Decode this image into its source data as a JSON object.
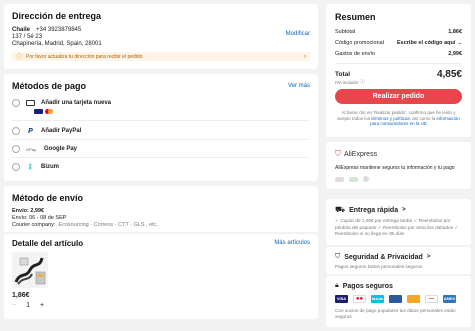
{
  "shipping_address": {
    "title": "Dirección de entrega",
    "name": "Chaile",
    "phone": "+34 3923879845",
    "street": "137 / 5é 23",
    "city": "Chapinería, Madrid, Spain, 28001",
    "edit_label": "Modificar",
    "notice": "Por favor actualiza tu dirección para recibir el pedido"
  },
  "payment": {
    "title": "Métodos de pago",
    "more_label": "Ver más",
    "methods": [
      {
        "label": "Añadir una tarjeta nueva"
      },
      {
        "label": "Añadir PayPal"
      },
      {
        "label": "Google Pay",
        "badge": "GPay"
      },
      {
        "label": "Bizum"
      }
    ]
  },
  "shipping_method": {
    "title": "Método de envío",
    "cost": "Envío: 2,99€",
    "eta": "Envío: 06 - 08 de SEP",
    "couriers_label": "Courier company:",
    "couriers": "Ecosourcing · Correos · CTT · GLS , etc."
  },
  "item_detail": {
    "title": "Detalle del artículo",
    "more_label": "Más artículos",
    "price": "1,86€",
    "quantity": "1",
    "minus": "−",
    "plus": "+"
  },
  "summary": {
    "title": "Resumen",
    "subtotal_label": "Subtotal",
    "subtotal_value": "1,86€",
    "promo_label": "Código promocional",
    "promo_value": "Escribe el código aquí",
    "shipping_label": "Gastos de envío",
    "shipping_value": "2,99€",
    "total_label": "Total",
    "total_value": "4,85€",
    "tax_note": "IVA incluido",
    "order_button": "Realizar pedido",
    "legal_prefix": "Al hacer clic en 'Realizar pedido', confirmo que he leído y acepto todos los",
    "legal_terms": "términos y políticas",
    "legal_mid": ", así como la",
    "legal_info": "información para consumidores en la UE"
  },
  "aliexpress": {
    "brand": "AliExpress",
    "text": "AliExpress mantiene seguros tu información y tu pago"
  },
  "delivery": {
    "title": "Entrega rápida",
    "chevron": ">",
    "text": "✓ Cupón de 1,00€ por entrega tardía  ✓ Reembolso por pérdida del paquete  ✓ Reembolso por artículos dañados  ✓ Reembolso si no llega en 35 días"
  },
  "security": {
    "title": "Seguridad & Privacidad",
    "chevron": ">",
    "text": "Pagos seguros   Datos personales seguros"
  },
  "secure_payments": {
    "title": "Pagos seguros",
    "logos": [
      "VISA",
      "",
      "bizum",
      "",
      "",
      "",
      "AMEX"
    ],
    "text": "Con socios de pago populares tus datos personales están seguros"
  },
  "colors": {
    "accent": "#e8464c",
    "link": "#0a66c2"
  }
}
